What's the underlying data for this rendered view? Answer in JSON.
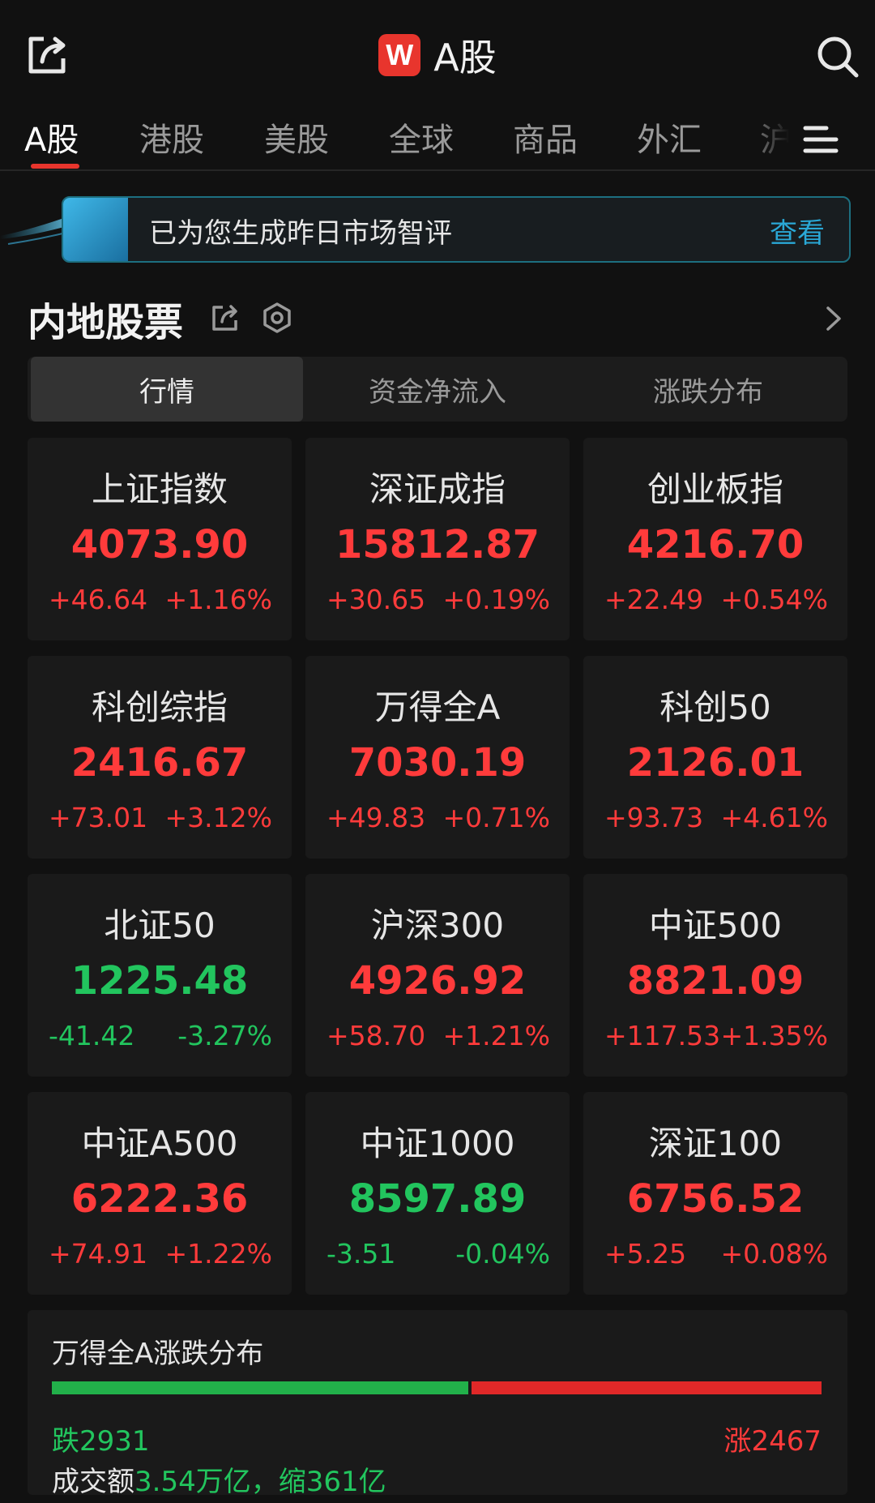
{
  "header": {
    "title": "A股",
    "logo_letter": "W",
    "accent": "#e8352d"
  },
  "tabs": [
    "A股",
    "港股",
    "美股",
    "全球",
    "商品",
    "外汇",
    "沪"
  ],
  "banner": {
    "text": "已为您生成昨日市场智评",
    "link": "查看"
  },
  "section": {
    "title": "内地股票"
  },
  "segments": [
    "行情",
    "资金净流入",
    "涨跌分布"
  ],
  "indices": [
    {
      "name": "上证指数",
      "value": "4073.90",
      "change": "+46.64",
      "pct": "+1.16%",
      "dir": "up"
    },
    {
      "name": "深证成指",
      "value": "15812.87",
      "change": "+30.65",
      "pct": "+0.19%",
      "dir": "up"
    },
    {
      "name": "创业板指",
      "value": "4216.70",
      "change": "+22.49",
      "pct": "+0.54%",
      "dir": "up"
    },
    {
      "name": "科创综指",
      "value": "2416.67",
      "change": "+73.01",
      "pct": "+3.12%",
      "dir": "up"
    },
    {
      "name": "万得全A",
      "value": "7030.19",
      "change": "+49.83",
      "pct": "+0.71%",
      "dir": "up"
    },
    {
      "name": "科创50",
      "value": "2126.01",
      "change": "+93.73",
      "pct": "+4.61%",
      "dir": "up"
    },
    {
      "name": "北证50",
      "value": "1225.48",
      "change": "-41.42",
      "pct": "-3.27%",
      "dir": "down"
    },
    {
      "name": "沪深300",
      "value": "4926.92",
      "change": "+58.70",
      "pct": "+1.21%",
      "dir": "up"
    },
    {
      "name": "中证500",
      "value": "8821.09",
      "change": "+117.53",
      "pct": "+1.35%",
      "dir": "up"
    },
    {
      "name": "中证A500",
      "value": "6222.36",
      "change": "+74.91",
      "pct": "+1.22%",
      "dir": "up"
    },
    {
      "name": "中证1000",
      "value": "8597.89",
      "change": "-3.51",
      "pct": "-0.04%",
      "dir": "down"
    },
    {
      "name": "深证100",
      "value": "6756.52",
      "change": "+5.25",
      "pct": "+0.08%",
      "dir": "up"
    }
  ],
  "distribution": {
    "title": "万得全A涨跌分布",
    "fall_label": "跌2931",
    "rise_label": "涨2467",
    "fall_count": 2931,
    "rise_count": 2467,
    "turnover_prefix": "成交额",
    "turnover_value": "3.54万亿，缩361亿"
  },
  "colors": {
    "up": "#ff3b3b",
    "down": "#22c55e"
  }
}
